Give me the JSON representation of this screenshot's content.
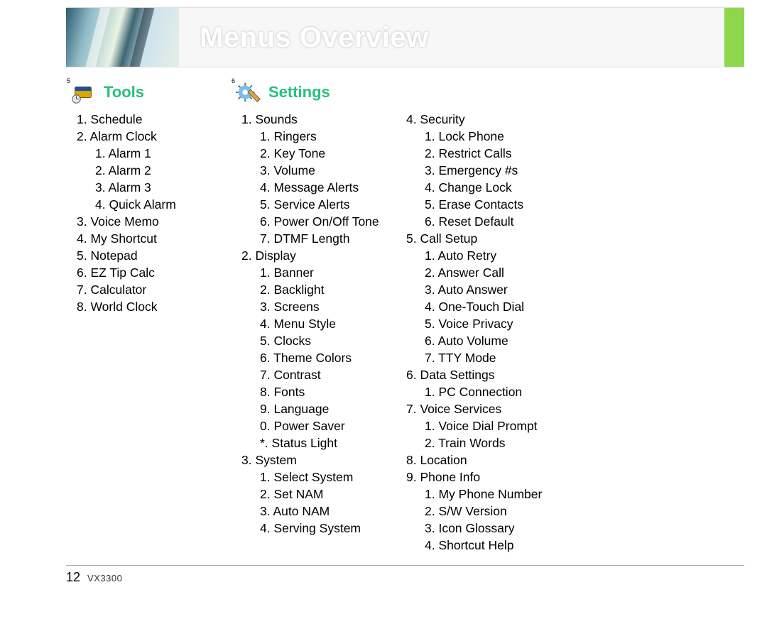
{
  "title": "Menus Overview",
  "footer": {
    "page": "12",
    "model": "VX3300"
  },
  "sections": {
    "tools": {
      "number": "5",
      "title": "Tools",
      "items": [
        {
          "n": "1",
          "label": "Schedule"
        },
        {
          "n": "2",
          "label": "Alarm Clock",
          "children": [
            {
              "n": "1",
              "label": "Alarm 1"
            },
            {
              "n": "2",
              "label": "Alarm 2"
            },
            {
              "n": "3",
              "label": "Alarm 3"
            },
            {
              "n": "4",
              "label": "Quick Alarm"
            }
          ]
        },
        {
          "n": "3",
          "label": "Voice Memo"
        },
        {
          "n": "4",
          "label": "My Shortcut"
        },
        {
          "n": "5",
          "label": "Notepad"
        },
        {
          "n": "6",
          "label": "EZ Tip Calc"
        },
        {
          "n": "7",
          "label": "Calculator"
        },
        {
          "n": "8",
          "label": "World Clock"
        }
      ]
    },
    "settings": {
      "number": "6",
      "title": "Settings",
      "col1": [
        {
          "n": "1",
          "label": "Sounds",
          "children": [
            {
              "n": "1",
              "label": "Ringers"
            },
            {
              "n": "2",
              "label": "Key Tone"
            },
            {
              "n": "3",
              "label": "Volume"
            },
            {
              "n": "4",
              "label": "Message Alerts"
            },
            {
              "n": "5",
              "label": "Service Alerts"
            },
            {
              "n": "6",
              "label": "Power On/Off Tone"
            },
            {
              "n": "7",
              "label": "DTMF Length"
            }
          ]
        },
        {
          "n": "2",
          "label": "Display",
          "children": [
            {
              "n": "1",
              "label": "Banner"
            },
            {
              "n": "2",
              "label": "Backlight"
            },
            {
              "n": "3",
              "label": "Screens"
            },
            {
              "n": "4",
              "label": "Menu Style"
            },
            {
              "n": "5",
              "label": "Clocks"
            },
            {
              "n": "6",
              "label": "Theme Colors"
            },
            {
              "n": "7",
              "label": "Contrast"
            },
            {
              "n": "8",
              "label": "Fonts"
            },
            {
              "n": "9",
              "label": "Language"
            },
            {
              "n": "0",
              "label": "Power Saver"
            },
            {
              "n": "*",
              "label": "Status Light"
            }
          ]
        },
        {
          "n": "3",
          "label": "System",
          "children": [
            {
              "n": "1",
              "label": "Select System"
            },
            {
              "n": "2",
              "label": "Set NAM"
            },
            {
              "n": "3",
              "label": "Auto NAM"
            },
            {
              "n": "4",
              "label": "Serving System"
            }
          ]
        }
      ],
      "col2": [
        {
          "n": "4",
          "label": "Security",
          "children": [
            {
              "n": "1",
              "label": "Lock Phone"
            },
            {
              "n": "2",
              "label": "Restrict Calls"
            },
            {
              "n": "3",
              "label": "Emergency #s"
            },
            {
              "n": "4",
              "label": "Change Lock"
            },
            {
              "n": "5",
              "label": "Erase Contacts"
            },
            {
              "n": "6",
              "label": "Reset Default"
            }
          ]
        },
        {
          "n": "5",
          "label": "Call Setup",
          "children": [
            {
              "n": "1",
              "label": "Auto Retry"
            },
            {
              "n": "2",
              "label": "Answer Call"
            },
            {
              "n": "3",
              "label": "Auto Answer"
            },
            {
              "n": "4",
              "label": "One-Touch Dial"
            },
            {
              "n": "5",
              "label": "Voice Privacy"
            },
            {
              "n": "6",
              "label": "Auto Volume"
            },
            {
              "n": "7",
              "label": "TTY Mode"
            }
          ]
        },
        {
          "n": "6",
          "label": "Data Settings",
          "children": [
            {
              "n": "1",
              "label": "PC Connection"
            }
          ]
        },
        {
          "n": "7",
          "label": "Voice Services",
          "children": [
            {
              "n": "1",
              "label": "Voice Dial Prompt"
            },
            {
              "n": "2",
              "label": "Train Words"
            }
          ]
        },
        {
          "n": "8",
          "label": "Location"
        },
        {
          "n": "9",
          "label": "Phone Info",
          "children": [
            {
              "n": "1",
              "label": "My Phone Number"
            },
            {
              "n": "2",
              "label": "S/W Version"
            },
            {
              "n": "3",
              "label": "Icon Glossary"
            },
            {
              "n": "4",
              "label": "Shortcut Help"
            }
          ]
        }
      ]
    }
  }
}
